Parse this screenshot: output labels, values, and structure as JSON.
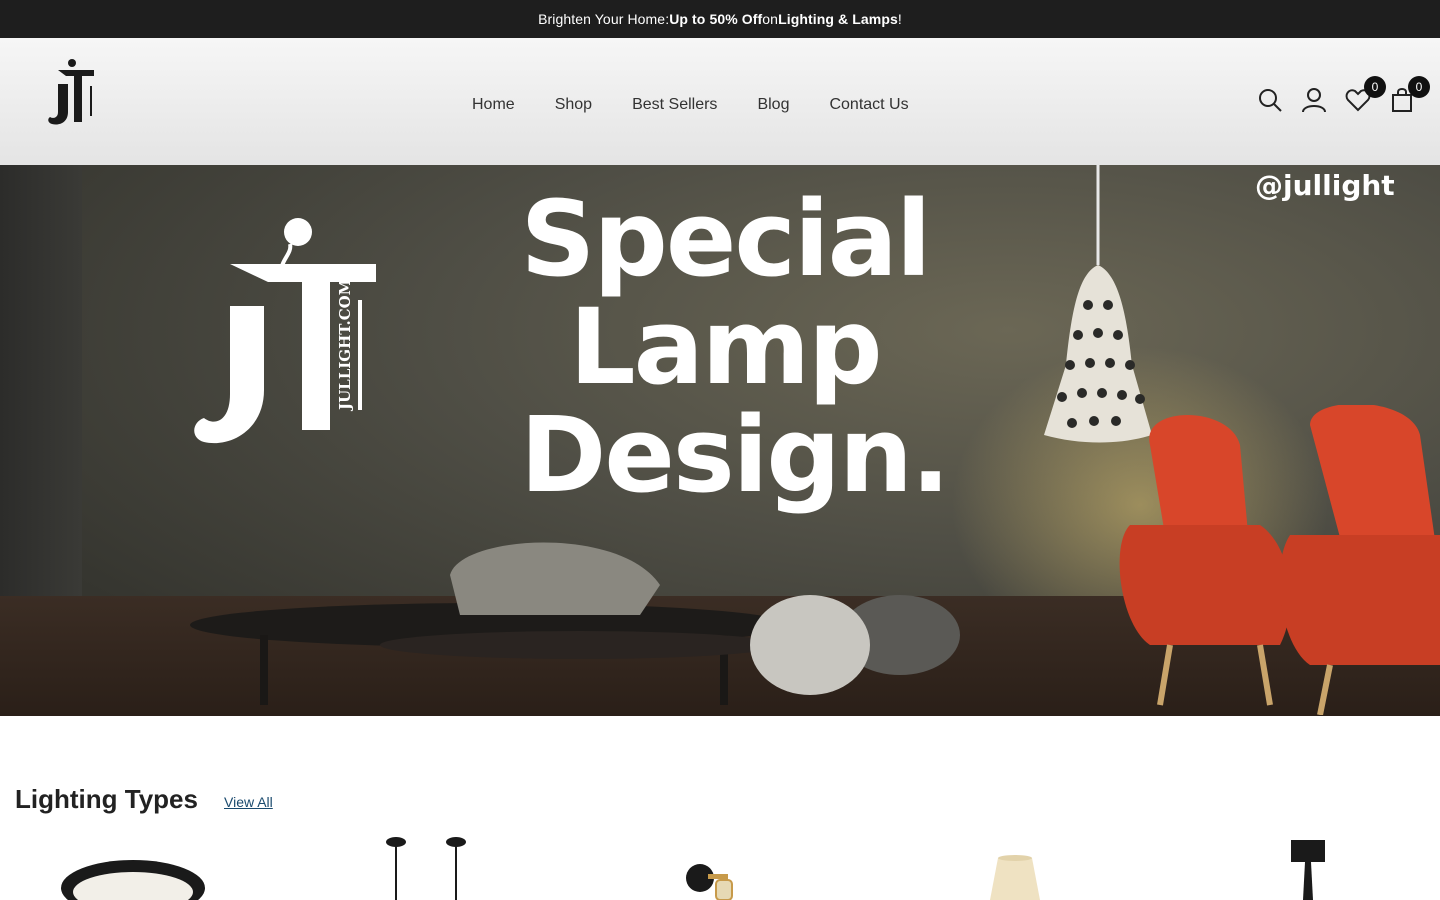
{
  "announcement": {
    "prefix": "Brighten Your Home: ",
    "offer": "Up to 50% Off",
    "middle": " on ",
    "category": "Lighting & Lamps",
    "suffix": "!"
  },
  "header": {
    "logo_alt": "JT JULLIGHT.COM",
    "nav": [
      {
        "label": "Home"
      },
      {
        "label": "Shop"
      },
      {
        "label": "Best Sellers"
      },
      {
        "label": "Blog"
      },
      {
        "label": "Contact Us"
      }
    ],
    "icons": {
      "search": "search-icon",
      "account": "user-icon",
      "wishlist": "heart-icon",
      "cart": "shopping-bag-icon"
    },
    "wishlist_count": "0",
    "cart_count": "0"
  },
  "hero": {
    "headline_lines": [
      "Special",
      "Lamp",
      "Design."
    ],
    "handle": "@jullight",
    "logo_text": "JULLIGHT.COM"
  },
  "section": {
    "title": "Lighting Types",
    "view_all": "View All"
  },
  "colors": {
    "announcement_bg": "#1e1e1e",
    "badge_bg": "#111111",
    "link": "#1a4a6e",
    "chair": "#d8462a"
  }
}
